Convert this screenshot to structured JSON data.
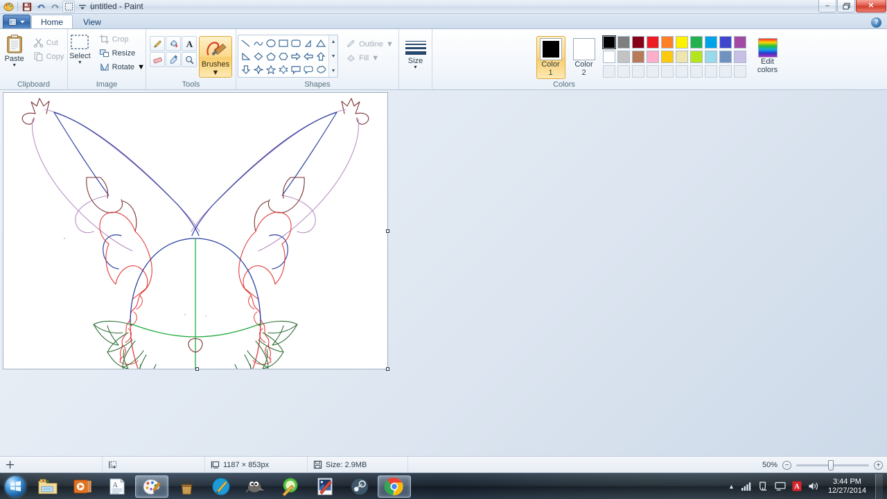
{
  "window": {
    "title": "untitled - Paint",
    "quick_access": [
      "paint-icon",
      "save-icon",
      "undo-icon",
      "redo-icon",
      "select-icon",
      "customize-icon"
    ],
    "controls": {
      "minimize": "–",
      "restore": "❐",
      "close": "✕"
    },
    "help": "?"
  },
  "ribbon": {
    "app_button": "file-menu",
    "tabs": [
      {
        "label": "Home",
        "active": true
      },
      {
        "label": "View",
        "active": false
      }
    ],
    "groups": [
      {
        "name": "Clipboard",
        "label": "Clipboard",
        "paste": "Paste",
        "items": [
          {
            "label": "Cut",
            "icon": "scissors-icon",
            "disabled": true
          },
          {
            "label": "Copy",
            "icon": "copy-icon",
            "disabled": true
          }
        ]
      },
      {
        "name": "Image",
        "label": "Image",
        "select": "Select",
        "items": [
          {
            "label": "Crop",
            "icon": "crop-icon",
            "disabled": true
          },
          {
            "label": "Resize",
            "icon": "resize-icon",
            "disabled": false
          },
          {
            "label": "Rotate",
            "icon": "rotate-icon",
            "disabled": false
          }
        ]
      },
      {
        "name": "Tools",
        "label": "Tools",
        "tools": [
          "pencil-icon",
          "fill-bucket-icon",
          "text-icon",
          "eraser-icon",
          "color-picker-icon",
          "magnifier-icon"
        ],
        "brushes": "Brushes"
      },
      {
        "name": "Shapes",
        "label": "Shapes",
        "shapes": [
          "line",
          "curve",
          "oval",
          "rectangle",
          "rounded-rectangle",
          "right-triangle",
          "triangle",
          "diamond",
          "diamond2",
          "pentagon",
          "hexagon",
          "arrow-right",
          "arrow-left",
          "arrow-up",
          "arrow-down",
          "four-point-star",
          "five-point-star",
          "six-point-star",
          "callout-rect",
          "callout-round",
          "callout-cloud"
        ],
        "outline": "Outline",
        "fill": "Fill"
      },
      {
        "name": "Size",
        "label": "",
        "size": "Size"
      },
      {
        "name": "Colors",
        "label": "Colors",
        "color1_label": "Color",
        "color1_num": "1",
        "color1_value": "#000000",
        "color2_label": "Color",
        "color2_num": "2",
        "color2_value": "#ffffff",
        "edit_colors_line1": "Edit",
        "edit_colors_line2": "colors",
        "palette_row1": [
          "#000000",
          "#7f7f7f",
          "#880015",
          "#ed1c24",
          "#ff7f27",
          "#fff200",
          "#22b14c",
          "#00a2e8",
          "#3f48cc",
          "#a349a4"
        ],
        "palette_row2": [
          "#ffffff",
          "#c3c3c3",
          "#b97a57",
          "#ffaec9",
          "#ffc90e",
          "#efe4b0",
          "#b5e61d",
          "#99d9ea",
          "#7092be",
          "#c8bfe7"
        ],
        "palette_row3": [
          "",
          "",
          "",
          "",
          "",
          "",
          "",
          "",
          "",
          ""
        ]
      }
    ]
  },
  "canvas": {
    "name": "drawing-canvas",
    "background": "#ffffff",
    "artwork_description": "pencil line drawing of a winged creature head",
    "stroke_colors": {
      "blue": "#2b3fa0",
      "red": "#e03b3b",
      "green": "#1faa3c",
      "violet": "#b98fc4",
      "maroon": "#7a3030",
      "darkgreen": "#2e6b35"
    }
  },
  "statusbar": {
    "cursor_icon": "crosshair-icon",
    "selection_icon": "selection-size-icon",
    "dimensions_icon": "canvas-size-icon",
    "dimensions": "1187 × 853px",
    "filesize_icon": "save-disk-icon",
    "filesize": "Size: 2.9MB",
    "zoom_level": "50%",
    "zoom_out": "−",
    "zoom_in": "+"
  },
  "taskbar": {
    "start": "start-orb",
    "buttons": [
      {
        "name": "windows-explorer",
        "icon": "folder-icon",
        "active": false
      },
      {
        "name": "windows-media-player",
        "icon": "media-player-icon",
        "active": false
      },
      {
        "name": "wordpad",
        "icon": "wordpad-icon",
        "active": false
      },
      {
        "name": "paint",
        "icon": "paint-palette-icon",
        "active": true
      },
      {
        "name": "pencil-cup-app",
        "icon": "pencil-cup-icon",
        "active": false
      },
      {
        "name": "paint-net",
        "icon": "paint-net-icon",
        "active": false
      },
      {
        "name": "gimp",
        "icon": "gimp-wilber-icon",
        "active": false
      },
      {
        "name": "sketchbook",
        "icon": "sketch-pencil-icon",
        "active": false
      },
      {
        "name": "photo-editor",
        "icon": "photo-brush-icon",
        "active": false
      },
      {
        "name": "steam",
        "icon": "steam-icon",
        "active": false
      },
      {
        "name": "google-chrome",
        "icon": "chrome-icon",
        "active": true
      }
    ],
    "tray": {
      "show_hidden": "▲",
      "icons": [
        "signal-bars-icon",
        "power-plug-icon",
        "network-monitor-icon",
        "adobe-reader-icon",
        "volume-icon"
      ],
      "time": "3:44 PM",
      "date": "12/27/2014"
    }
  }
}
